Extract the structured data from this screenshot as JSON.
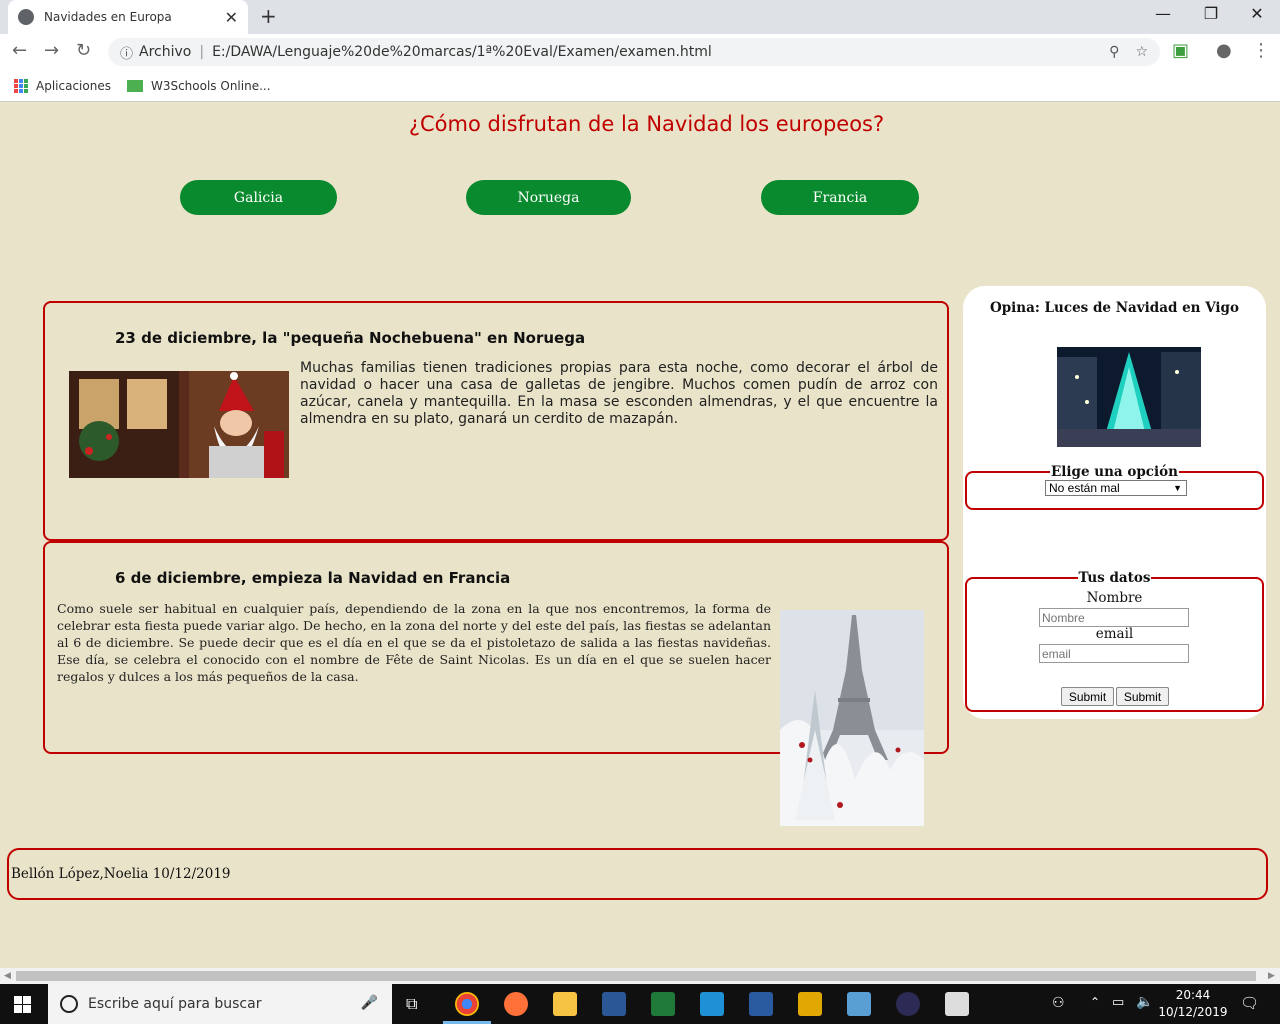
{
  "browser": {
    "tab_title": "Navidades en Europa",
    "address_prefix": "Archivo",
    "url": "E:/DAWA/Lenguaje%20de%20marcas/1ª%20Eval/Examen/examen.html",
    "bookmarks": [
      {
        "label": "Aplicaciones"
      },
      {
        "label": "W3Schools Online..."
      }
    ]
  },
  "page": {
    "title": "¿Cómo disfrutan de la Navidad los europeos?",
    "nav": [
      {
        "label": "Galicia"
      },
      {
        "label": "Noruega"
      },
      {
        "label": "Francia"
      }
    ],
    "articles": [
      {
        "heading": "23 de diciembre, la \"pequeña Nochebuena\" en Noruega",
        "text": "Muchas familias tienen tradiciones propias para esta noche, como decorar el árbol de navidad o hacer una casa de galletas de jengibre. Muchos comen pudín de arroz con azúcar, canela y mantequilla. En la masa se esconden almendras, y el que encuentre la almendra en su plato, ganará un cerdito de mazapán."
      },
      {
        "heading": "6 de diciembre, empieza la Navidad en Francia",
        "text": "Como suele ser habitual en cualquier país, dependiendo de la zona en la que nos encontremos, la forma de celebrar esta fiesta puede variar algo. De hecho, en la zona del norte y del este del país, las fiestas se adelantan al 6 de diciembre. Se puede decir que es el día en el que se da el pistoletazo de salida a las fiestas navideñas. Ese día, se celebra el conocido con el nombre de Fête de Saint Nicolas. Es un día en el que se suelen hacer regalos y dulces a los más pequeños de la casa."
      }
    ],
    "aside": {
      "title": "Opina: Luces de Navidad en Vigo",
      "legend_option": "Elige una opción",
      "select_value": "No están mal",
      "legend_data": "Tus datos",
      "name_label": "Nombre",
      "name_placeholder": "Nombre",
      "email_label": "email",
      "email_placeholder": "email",
      "submit1": "Submit",
      "submit2": "Submit"
    },
    "footer": "Bellón López,Noelia 10/12/2019"
  },
  "taskbar": {
    "search_placeholder": "Escribe aquí para buscar",
    "time": "20:44",
    "date": "10/12/2019"
  }
}
